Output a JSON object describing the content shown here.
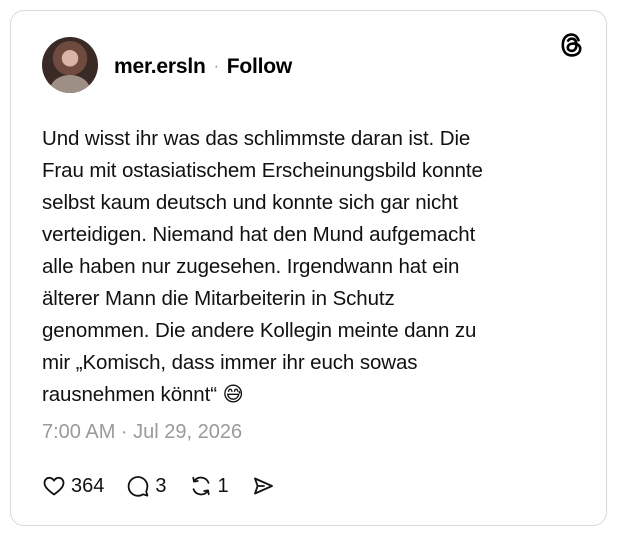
{
  "post": {
    "username": "mer.ersln",
    "separator": "·",
    "follow_label": "Follow",
    "text": "Und wisst ihr was das schlimmste daran ist. Die\nFrau mit ostasiatischem Erscheinungsbild konnte\nselbst kaum deutsch und konnte sich gar nicht\nverteidigen. Niemand hat den Mund aufgemacht\nalle haben nur zugesehen. Irgendwann hat ein\nälterer Mann die Mitarbeiterin in Schutz\ngenommen. Die andere Kollegin meinte dann zu\nmir „Komisch, dass immer ihr euch sowas\nrausnehmen könnt“ 😅",
    "timestamp": "7:00 AM · Jul 29, 2026"
  },
  "actions": {
    "likes": "364",
    "replies": "3",
    "reposts": "1"
  },
  "icons": {
    "brand": "threads-logo-icon",
    "like": "heart-icon",
    "reply": "comment-bubble-icon",
    "repost": "repost-arrows-icon",
    "share": "send-icon"
  }
}
